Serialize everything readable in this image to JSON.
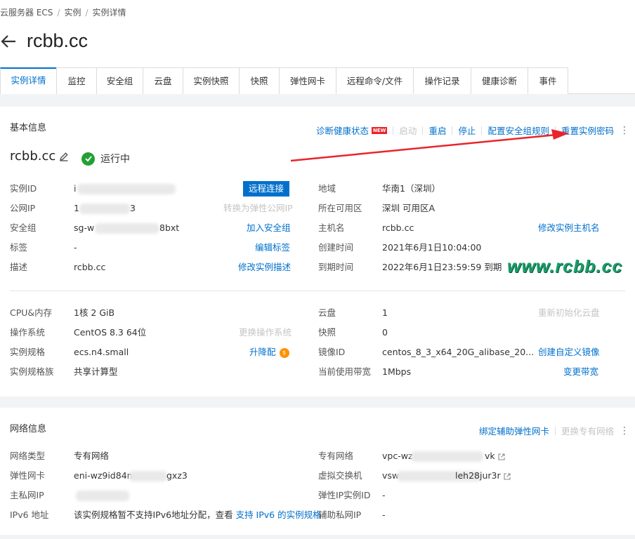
{
  "breadcrumb": {
    "item1": "云服务器 ECS",
    "sep": "/",
    "item2": "实例",
    "item3": "实例详情"
  },
  "page_title": "rcbb.cc",
  "tabs": [
    "实例详情",
    "监控",
    "安全组",
    "云盘",
    "实例快照",
    "快照",
    "弹性网卡",
    "远程命令/文件",
    "操作记录",
    "健康诊断",
    "事件"
  ],
  "basic": {
    "title": "基本信息",
    "actions": {
      "diagnose": "诊断健康状态",
      "new_badge": "NEW",
      "start": "启动",
      "restart": "重启",
      "stop": "停止",
      "config_sg_rule": "配置安全组规则",
      "reset_password": "重置实例密码"
    },
    "hostname": "rcbb.cc",
    "status": "运行中",
    "left": [
      {
        "label": "实例ID",
        "value": "i",
        "action": "远程连接"
      },
      {
        "label": "公网IP",
        "value": "1",
        "value2": "3",
        "action": "转换为弹性公网IP"
      },
      {
        "label": "安全组",
        "value": "sg-w",
        "value2": "8bxt",
        "action": "加入安全组"
      },
      {
        "label": "标签",
        "value": "-",
        "action": "编辑标签"
      },
      {
        "label": "描述",
        "value": "rcbb.cc",
        "action": "修改实例描述"
      }
    ],
    "right": [
      {
        "label": "地域",
        "value": "华南1（深圳）"
      },
      {
        "label": "所在可用区",
        "value": "深圳 可用区A"
      },
      {
        "label": "主机名",
        "value": "rcbb.cc",
        "action": "修改实例主机名"
      },
      {
        "label": "创建时间",
        "value": "2021年6月1日10:04:00"
      },
      {
        "label": "到期时间",
        "value": "2022年6月1日23:59:59 到期"
      }
    ],
    "left2": [
      {
        "label": "CPU&内存",
        "value": "1核 2 GiB"
      },
      {
        "label": "操作系统",
        "value": "CentOS 8.3 64位",
        "action": "更换操作系统"
      },
      {
        "label": "实例规格",
        "value": "ecs.n4.small",
        "action": "升降配"
      },
      {
        "label": "实例规格族",
        "value": "共享计算型"
      }
    ],
    "right2": [
      {
        "label": "云盘",
        "value": "1",
        "action": "重新初始化云盘"
      },
      {
        "label": "快照",
        "value": "0"
      },
      {
        "label": "镜像ID",
        "value": "centos_8_3_x64_20G_alibase_20...",
        "action": "创建自定义镜像"
      },
      {
        "label": "当前使用带宽",
        "value": "1Mbps",
        "action": "变更带宽"
      }
    ]
  },
  "network": {
    "title": "网络信息",
    "actions": {
      "bind_eni": "绑定辅助弹性网卡",
      "change_vpc": "更换专有网络"
    },
    "left": [
      {
        "label": "网络类型",
        "value": "专有网络"
      },
      {
        "label": "弹性网卡",
        "value": "eni-wz9id84n",
        "value2": "gxz3"
      },
      {
        "label": "主私网IP",
        "value": ""
      },
      {
        "label": "IPv6 地址",
        "value": "该实例规格暂不支持IPv6地址分配，查看",
        "link": "支持 IPv6 的实例规格"
      }
    ],
    "right": [
      {
        "label": "专有网络",
        "value": "vpc-wz",
        "value2": "vk"
      },
      {
        "label": "虚拟交换机",
        "value": "vsw",
        "value2": "leh28jur3r"
      },
      {
        "label": "弹性IP实例ID",
        "value": "-"
      },
      {
        "label": "辅助私网IP",
        "value": "-"
      }
    ]
  },
  "watermark": "www.rcbb.cc",
  "colors": {
    "link": "#0070cc",
    "status_ok": "#23a032",
    "arrow": "#e8252b",
    "watermark": "#1a9e6b"
  }
}
